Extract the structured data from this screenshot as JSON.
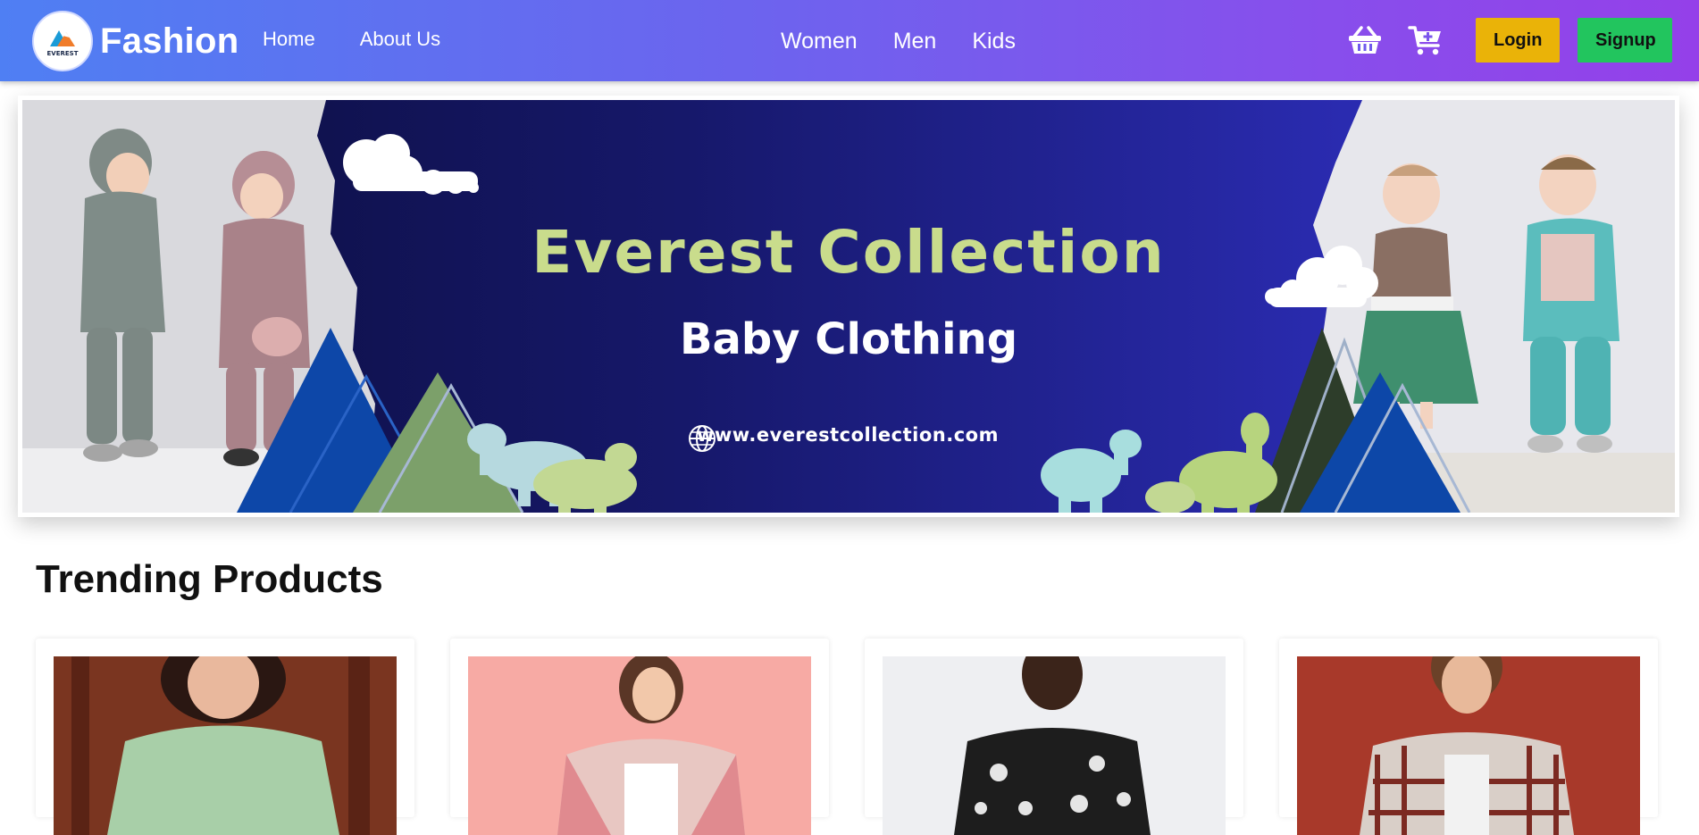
{
  "navbar": {
    "brand": "Fashion",
    "logo_text": "EVEREST",
    "links_left": [
      "Home",
      "About Us"
    ],
    "links_center": [
      "Women",
      "Men",
      "Kids"
    ],
    "icons": [
      "basket-icon",
      "cart-plus-icon"
    ],
    "login_label": "Login",
    "signup_label": "Signup",
    "colors": {
      "gradient_start": "#4f7ff3",
      "gradient_end": "#9440e9",
      "login_bg": "#eab308",
      "signup_bg": "#22c55e"
    }
  },
  "hero": {
    "title": "Everest Collection",
    "subtitle": "Baby Clothing",
    "url": "www.everestcollection.com",
    "colors": {
      "background": "#16186a",
      "title": "#c9dc8c",
      "subtitle": "#ffffff"
    }
  },
  "trending": {
    "heading": "Trending Products",
    "products": [
      {
        "image": "woman-green-shirt",
        "bg": "#6b2f1e"
      },
      {
        "image": "woman-pink-cardigan",
        "bg": "#f6a6a0"
      },
      {
        "image": "man-floral-shirt",
        "bg": "#eeeff2"
      },
      {
        "image": "man-plaid-shirt",
        "bg": "#a8392a"
      }
    ]
  }
}
